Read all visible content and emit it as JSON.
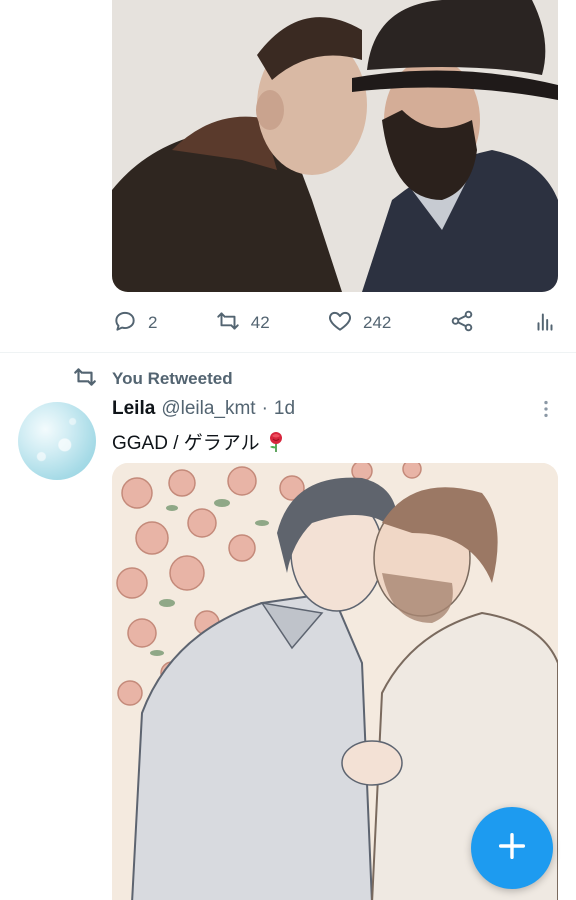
{
  "tweet_top": {
    "stats": {
      "replies": "2",
      "retweets": "42",
      "likes": "242"
    },
    "icons": [
      "reply-icon",
      "retweet-icon",
      "like-icon",
      "share-icon",
      "analytics-icon"
    ]
  },
  "tweet_main": {
    "social_context": "You Retweeted",
    "author_name": "Leila",
    "author_handle": "@leila_kmt",
    "separator": "·",
    "timestamp": "1d",
    "text": "GGAD / ゲラアル",
    "emoji": "rose"
  },
  "fab": {
    "icon": "plus-icon"
  },
  "colors": {
    "accent": "#1d9bf0",
    "secondary_text": "#536471",
    "primary_text": "#0f1419"
  }
}
